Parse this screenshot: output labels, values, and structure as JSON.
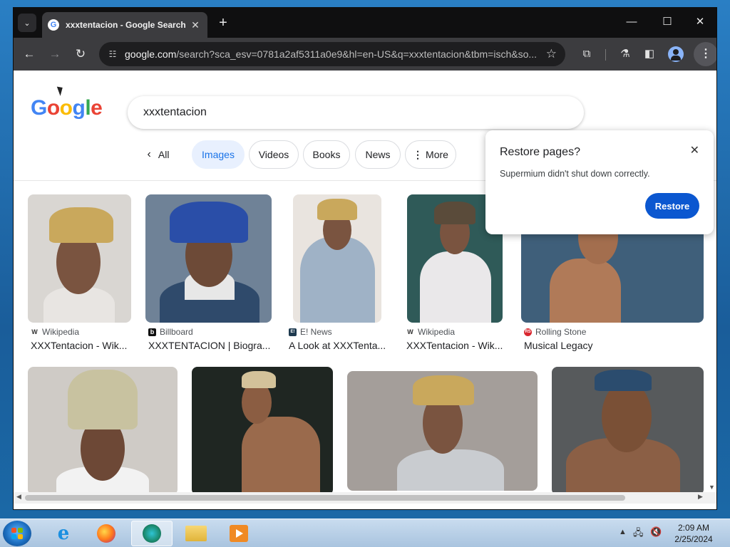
{
  "browser": {
    "tab_title": "xxxtentacion - Google Search",
    "url_domain": "google.com",
    "url_path": "/search?sca_esv=0781a2af5311a0e9&hl=en-US&q=xxxtentacion&tbm=isch&so...",
    "new_tab_symbol": "+",
    "controls": {
      "minimize": "—",
      "maximize": "☐",
      "close": "✕"
    }
  },
  "search": {
    "logo": [
      "G",
      "o",
      "o",
      "g",
      "l",
      "e"
    ],
    "logo_colors": [
      "#4285f4",
      "#ea4335",
      "#fbbc05",
      "#4285f4",
      "#34a853",
      "#ea4335"
    ],
    "query": "xxxtentacion"
  },
  "chips": {
    "back": "All",
    "items": [
      "Images",
      "Videos",
      "Books",
      "News",
      "More"
    ],
    "active": "Images"
  },
  "results_row1": [
    {
      "source": "Wikipedia",
      "source_icon": "W",
      "caption": "XXXTentacion - Wik..."
    },
    {
      "source": "Billboard",
      "source_icon": "b",
      "caption": "XXXTENTACION | Biogra..."
    },
    {
      "source": "E! News",
      "source_icon": "E!",
      "caption": "A Look at XXXTenta..."
    },
    {
      "source": "Wikipedia",
      "source_icon": "W",
      "caption": "XXXTentacion - Wik..."
    },
    {
      "source": "Rolling Stone",
      "source_icon": "RS",
      "caption": "Musical Legacy"
    }
  ],
  "popup": {
    "title": "Restore pages?",
    "body": "Supermium didn't shut down correctly.",
    "button": "Restore"
  },
  "taskbar": {
    "time": "2:09 AM",
    "date": "2/25/2024"
  },
  "colors": {
    "accent": "#1a73e8",
    "restore_button": "#0b57d0",
    "titlebar": "#0f0f10",
    "toolbar": "#3c3c3f"
  }
}
